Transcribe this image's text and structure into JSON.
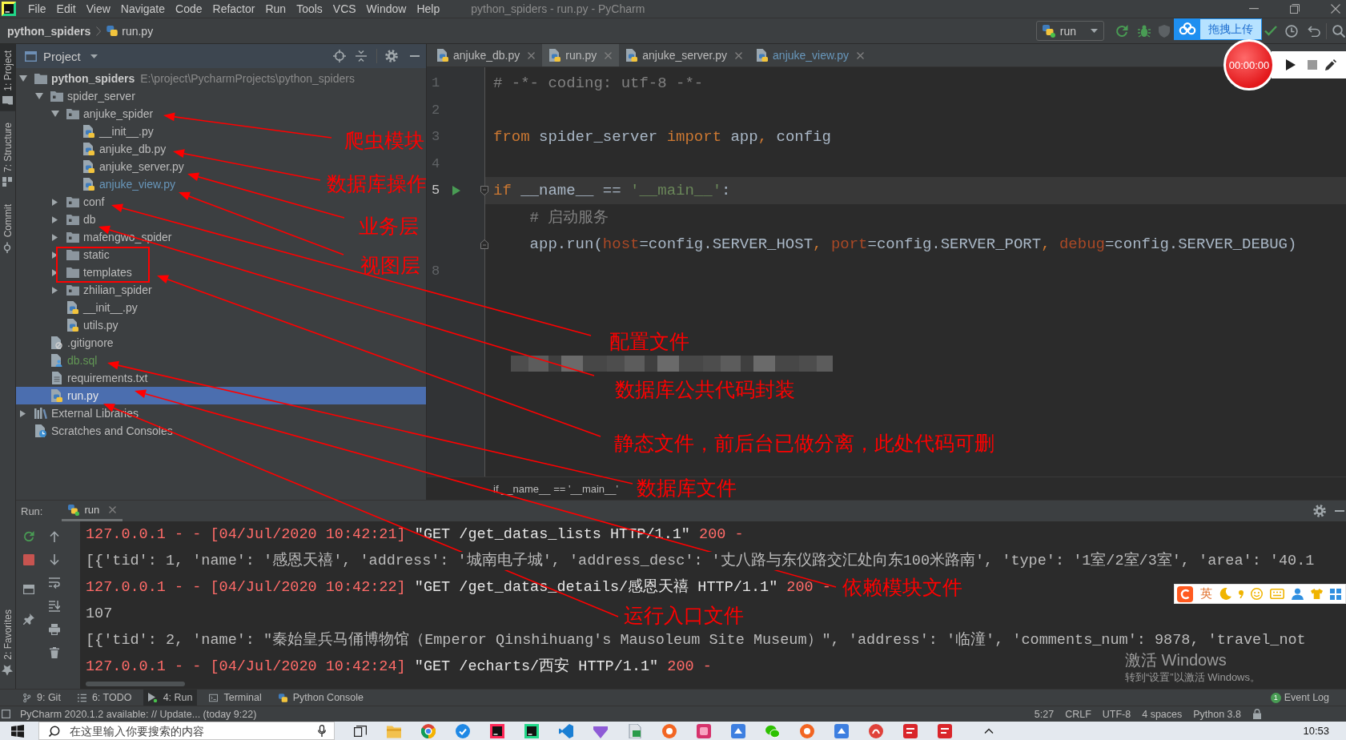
{
  "window": {
    "title": "python_spiders - run.py - PyCharm"
  },
  "menu": [
    "File",
    "Edit",
    "View",
    "Navigate",
    "Code",
    "Refactor",
    "Run",
    "Tools",
    "VCS",
    "Window",
    "Help"
  ],
  "navigation_bar": {
    "breadcrumbs": [
      {
        "label": "python_spiders",
        "kind": "project"
      },
      {
        "label": "run.py",
        "kind": "python"
      }
    ],
    "run_configuration": "run"
  },
  "upload_widget": {
    "label": "拖拽上传"
  },
  "screen_recorder": {
    "time": "00:00:00"
  },
  "tool_stripe": {
    "top": [
      {
        "label": "1: Project",
        "kind": "project",
        "selected": true
      },
      {
        "label": "7: Structure",
        "kind": "structure",
        "selected": false
      },
      {
        "label": "Commit",
        "kind": "commit",
        "selected": false
      }
    ],
    "bottom": [
      {
        "label": "2: Favorites",
        "kind": "favorites",
        "selected": false
      }
    ]
  },
  "project_panel": {
    "title": "Project",
    "tree": [
      {
        "label": "python_spiders",
        "kind": "root",
        "path": "E:\\project\\PycharmProjects\\python_spiders",
        "expanded": true,
        "selected": false,
        "children": [
          {
            "label": "spider_server",
            "kind": "package",
            "expanded": true,
            "selected": false,
            "children": [
              {
                "label": "anjuke_spider",
                "kind": "package",
                "expanded": true,
                "selected": false,
                "children": [
                  {
                    "label": "__init__.py",
                    "kind": "python",
                    "selected": false
                  },
                  {
                    "label": "anjuke_db.py",
                    "kind": "python",
                    "selected": false
                  },
                  {
                    "label": "anjuke_server.py",
                    "kind": "python",
                    "selected": false
                  },
                  {
                    "label": "anjuke_view.py",
                    "kind": "python",
                    "selected": false,
                    "color": "#6897bb"
                  }
                ]
              },
              {
                "label": "conf",
                "kind": "package",
                "expanded": false,
                "selected": false
              },
              {
                "label": "db",
                "kind": "package",
                "expanded": false,
                "selected": false
              },
              {
                "label": "mafengwo_spider",
                "kind": "package",
                "expanded": false,
                "selected": false
              },
              {
                "label": "static",
                "kind": "folder",
                "expanded": false,
                "selected": false
              },
              {
                "label": "templates",
                "kind": "folder",
                "expanded": false,
                "selected": false
              },
              {
                "label": "zhilian_spider",
                "kind": "package",
                "expanded": false,
                "selected": false
              },
              {
                "label": "__init__.py",
                "kind": "python",
                "selected": false
              },
              {
                "label": "utils.py",
                "kind": "python",
                "selected": false
              }
            ]
          },
          {
            "label": ".gitignore",
            "kind": "ignore",
            "selected": false
          },
          {
            "label": "db.sql",
            "kind": "sql",
            "selected": false,
            "color": "#629755"
          },
          {
            "label": "requirements.txt",
            "kind": "text",
            "selected": false
          },
          {
            "label": "run.py",
            "kind": "python",
            "selected": true
          }
        ]
      },
      {
        "label": "External Libraries",
        "kind": "libraries",
        "expanded": false,
        "selected": false
      },
      {
        "label": "Scratches and Consoles",
        "kind": "scratches",
        "selected": false
      }
    ]
  },
  "editor": {
    "tabs": [
      {
        "label": "anjuke_db.py",
        "selected": false
      },
      {
        "label": "run.py",
        "selected": true
      },
      {
        "label": "anjuke_server.py",
        "selected": false
      },
      {
        "label": "anjuke_view.py",
        "selected": false,
        "color": "#6897bb"
      }
    ],
    "lines": [
      {
        "number": "1",
        "current": false,
        "run_marker": false,
        "fold_start": false,
        "fold_end": false,
        "tokens": [
          {
            "text": "# -*- coding: utf-8 -*-",
            "kind": "comment"
          }
        ]
      },
      {
        "number": "2",
        "current": false,
        "run_marker": false,
        "fold_start": false,
        "fold_end": false
      },
      {
        "number": "3",
        "current": false,
        "run_marker": false,
        "fold_start": false,
        "fold_end": false,
        "tokens": [
          {
            "text": "from",
            "kind": "keyword"
          },
          {
            "text": " spider_server ",
            "kind": "plain"
          },
          {
            "text": "import",
            "kind": "keyword"
          },
          {
            "text": " app",
            "kind": "plain"
          },
          {
            "text": ",",
            "kind": "punct"
          },
          {
            "text": " config",
            "kind": "plain"
          }
        ]
      },
      {
        "number": "4",
        "current": false,
        "run_marker": false,
        "fold_start": false,
        "fold_end": false
      },
      {
        "number": "5",
        "current": true,
        "run_marker": true,
        "fold_start": true,
        "fold_end": false,
        "tokens": [
          {
            "text": "if",
            "kind": "keyword"
          },
          {
            "text": " __name__ == ",
            "kind": "plain"
          },
          {
            "text": "'__main__'",
            "kind": "string"
          },
          {
            "text": ":",
            "kind": "plain"
          }
        ]
      },
      {
        "current": false,
        "run_marker": false,
        "fold_start": false,
        "fold_end": false,
        "tokens": [
          {
            "text": "    # 启动服务",
            "kind": "comment"
          }
        ]
      },
      {
        "current": false,
        "run_marker": false,
        "fold_start": false,
        "fold_end": true,
        "tokens": [
          {
            "text": "    app.run(",
            "kind": "plain"
          },
          {
            "text": "host",
            "kind": "param"
          },
          {
            "text": "=config.SERVER_HOST",
            "kind": "plain"
          },
          {
            "text": ", ",
            "kind": "punct"
          },
          {
            "text": "port",
            "kind": "param"
          },
          {
            "text": "=config.SERVER_PORT",
            "kind": "plain"
          },
          {
            "text": ", ",
            "kind": "punct"
          },
          {
            "text": "debug",
            "kind": "param"
          },
          {
            "text": "=config.SERVER_DEBUG)",
            "kind": "plain"
          }
        ]
      },
      {
        "number": "8",
        "current": false,
        "run_marker": false,
        "fold_start": false,
        "fold_end": false
      }
    ],
    "breadcrumb": "if __name__ == '__main__'"
  },
  "run_panel": {
    "title": "Run:",
    "tabs": [
      {
        "label": "run",
        "selected": true
      }
    ],
    "lines": [
      {
        "kind": "err",
        "text": "127.0.0.1 - - [04/Jul/2020 10:42:21] **\"GET /get_datas_lists HTTP/1.1\"** 200 -"
      },
      {
        "kind": "out",
        "text": "[{'tid': 1, 'name': '感恩天禧', 'address': '城南电子城', 'address_desc': '丈八路与东仪路交汇处向东100米路南', 'type': '1室/2室/3室', 'area': '40.1"
      },
      {
        "kind": "err",
        "text": "127.0.0.1 - - [04/Jul/2020 10:42:22] **\"GET /get_datas_details/感恩天禧 HTTP/1.1\"** 200 -"
      },
      {
        "kind": "out",
        "text": "107"
      },
      {
        "kind": "out",
        "text": "[{'tid': 2, 'name': \"秦始皇兵马俑博物馆（Emperor Qinshihuang's Mausoleum Site Museum）\", 'address': '临潼', 'comments_num': 9878, 'travel_not"
      },
      {
        "kind": "err",
        "text": "127.0.0.1 - - [04/Jul/2020 10:42:24] **\"GET /echarts/西安 HTTP/1.1\"** 200 -"
      }
    ]
  },
  "input_method_bar": {
    "mode": "英"
  },
  "activation_notice": {
    "title": "激活 Windows",
    "message": "转到“设置”以激活 Windows。"
  },
  "tool_buttons": [
    {
      "label": "9: Git",
      "kind": "git",
      "selected": false
    },
    {
      "label": "6: TODO",
      "kind": "todo",
      "selected": false
    },
    {
      "label": "4: Run",
      "kind": "run",
      "selected": true
    },
    {
      "label": "Terminal",
      "kind": "terminal",
      "selected": false
    },
    {
      "label": "Python Console",
      "kind": "console",
      "selected": false
    }
  ],
  "event_log": {
    "label": "Event Log",
    "count": "1"
  },
  "status_bar": {
    "message": "PyCharm 2020.1.2 available: // Update... (today 9:22)",
    "items": [
      "5:27",
      "CRLF",
      "UTF-8",
      "4 spaces",
      "Python 3.8"
    ]
  },
  "taskbar": {
    "search": {
      "placeholder": "在这里输入你要搜索的内容"
    },
    "clock": "10:53"
  },
  "annotations": [
    {
      "label": "爬虫模块"
    },
    {
      "label": "数据库操作"
    },
    {
      "label": "业务层"
    },
    {
      "label": "视图层"
    },
    {
      "label": "配置文件"
    },
    {
      "label": "数据库公共代码封装"
    },
    {
      "label": "静态文件，前后台已做分离，此处代码可删"
    },
    {
      "label": "数据库文件"
    },
    {
      "label": "依赖模块文件"
    },
    {
      "label": "运行入口文件"
    }
  ]
}
